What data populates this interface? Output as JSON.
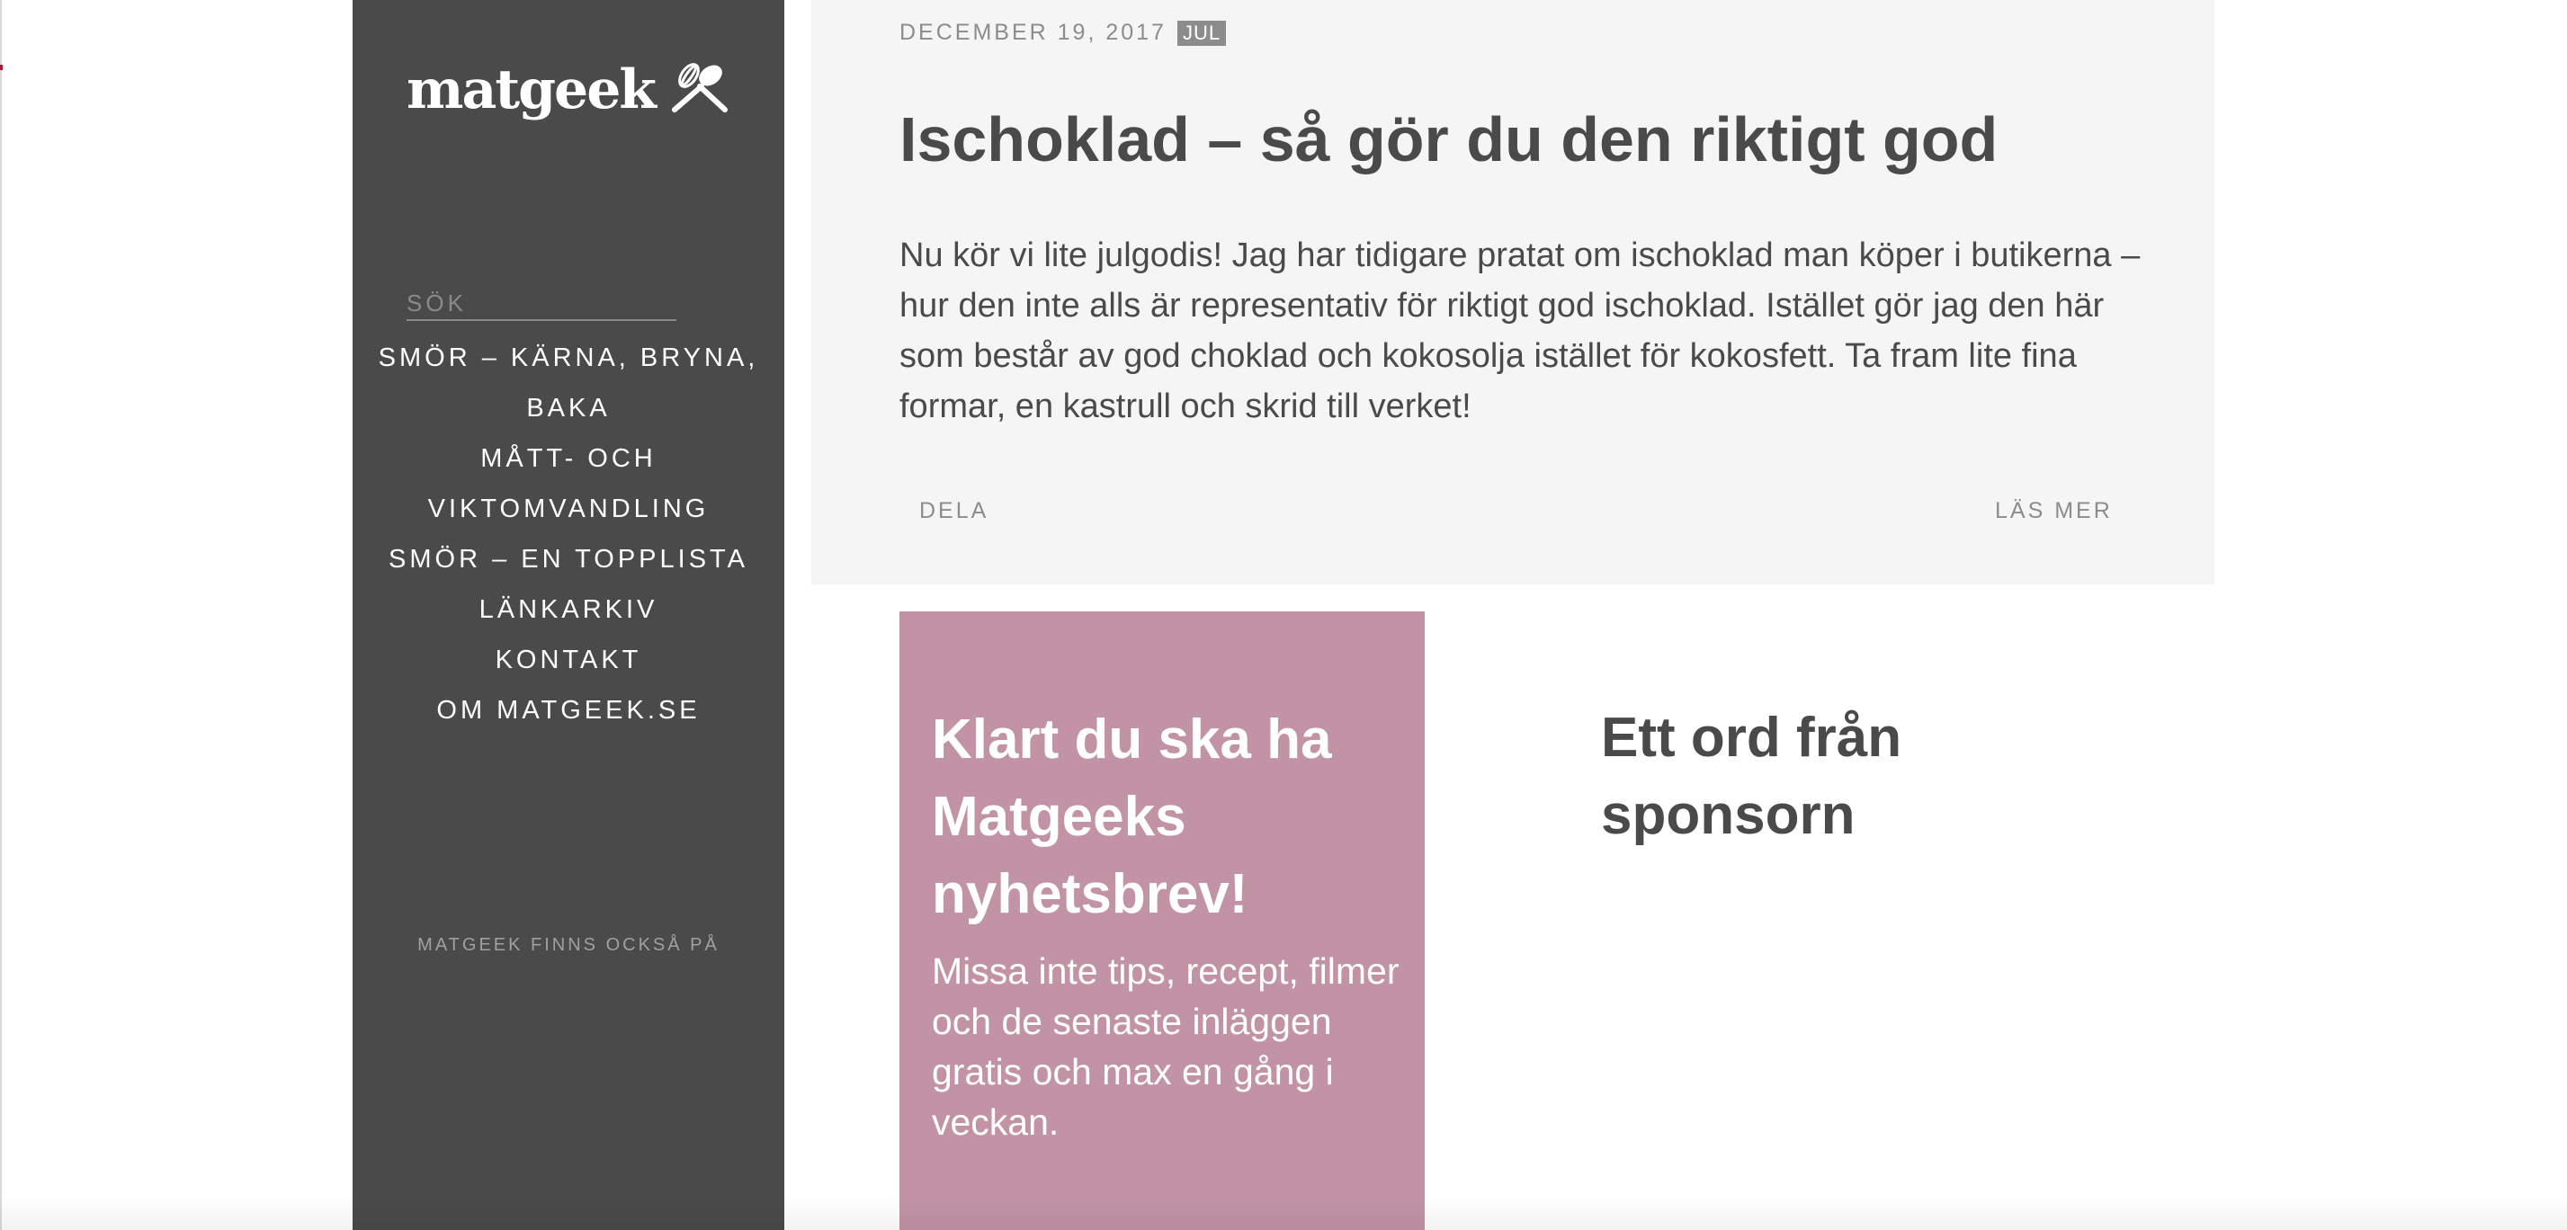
{
  "sidebar": {
    "logo_text": "matgeek",
    "search_label": "SÖK",
    "nav_items": [
      {
        "label": "SMÖR – KÄRNA, BRYNA, BAKA"
      },
      {
        "label": "MÅTT- OCH VIKTOMVANDLING"
      },
      {
        "label": "SMÖR – EN TOPPLISTA"
      },
      {
        "label": "LÄNKARKIV"
      },
      {
        "label": "KONTAKT"
      },
      {
        "label": "OM MATGEEK.SE"
      }
    ],
    "social_label": "MATGEEK FINNS OCKSÅ PÅ"
  },
  "post": {
    "date": "DECEMBER 19, 2017",
    "tag": "JUL",
    "title": "Ischoklad – så gör du den riktigt god",
    "excerpt": "Nu kör vi lite julgodis! Jag har tidigare pratat om ischoklad man köper i butikerna – hur den inte alls är representativ för riktigt god ischoklad. Istället gör jag den här som består av god choklad och kokosolja istället för kokosfett. Ta fram lite fina formar, en kastrull och skrid till verket!",
    "share_label": "DELA",
    "read_more_label": "LÄS MER"
  },
  "newsletter": {
    "title": "Klart du ska ha Matgeeks nyhetsbrev!",
    "text": "Missa inte tips, recept, filmer och de senaste inläggen gratis och max en gång i veckan.",
    "background_color": "#c193a5"
  },
  "sponsor": {
    "title": "Ett ord från sponsorn"
  },
  "colors": {
    "sidebar": "#4a4a4a",
    "card": "#f5f5f5",
    "text": "#4a4a4a",
    "muted": "#8c8c8c"
  },
  "icons": {
    "logo": "whisk-spatula-icon"
  }
}
